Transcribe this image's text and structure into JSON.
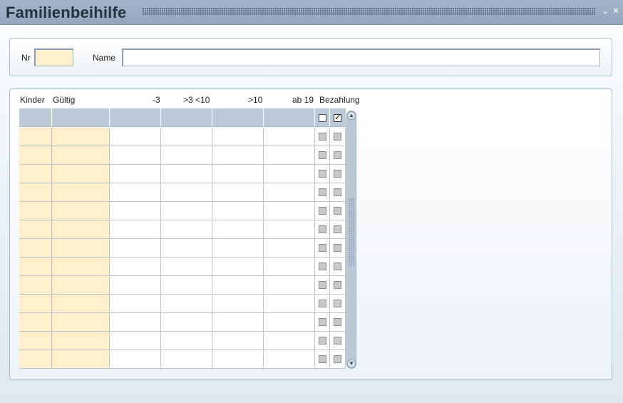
{
  "window": {
    "title": "Familienbeihilfe",
    "buttons": {
      "minimize_glyph": "⌄",
      "close_glyph": "✕"
    }
  },
  "header_form": {
    "nr_label": "Nr",
    "nr_value": "",
    "name_label": "Name",
    "name_value": ""
  },
  "table": {
    "columns": [
      "Kinder",
      "Gültig",
      "-3",
      ">3 <10",
      ">10",
      "ab 19",
      "Bezahlung"
    ],
    "header_row": {
      "checkbox_1_checked": false,
      "checkbox_2_checked": true
    },
    "row_count": 13,
    "rows": [
      {
        "kinder": "",
        "gueltig": "",
        "u3": "",
        "b3_10": "",
        "ue10": "",
        "ab19": "",
        "bez1": false,
        "bez2": false
      },
      {
        "kinder": "",
        "gueltig": "",
        "u3": "",
        "b3_10": "",
        "ue10": "",
        "ab19": "",
        "bez1": false,
        "bez2": false
      },
      {
        "kinder": "",
        "gueltig": "",
        "u3": "",
        "b3_10": "",
        "ue10": "",
        "ab19": "",
        "bez1": false,
        "bez2": false
      },
      {
        "kinder": "",
        "gueltig": "",
        "u3": "",
        "b3_10": "",
        "ue10": "",
        "ab19": "",
        "bez1": false,
        "bez2": false
      },
      {
        "kinder": "",
        "gueltig": "",
        "u3": "",
        "b3_10": "",
        "ue10": "",
        "ab19": "",
        "bez1": false,
        "bez2": false
      },
      {
        "kinder": "",
        "gueltig": "",
        "u3": "",
        "b3_10": "",
        "ue10": "",
        "ab19": "",
        "bez1": false,
        "bez2": false
      },
      {
        "kinder": "",
        "gueltig": "",
        "u3": "",
        "b3_10": "",
        "ue10": "",
        "ab19": "",
        "bez1": false,
        "bez2": false
      },
      {
        "kinder": "",
        "gueltig": "",
        "u3": "",
        "b3_10": "",
        "ue10": "",
        "ab19": "",
        "bez1": false,
        "bez2": false
      },
      {
        "kinder": "",
        "gueltig": "",
        "u3": "",
        "b3_10": "",
        "ue10": "",
        "ab19": "",
        "bez1": false,
        "bez2": false
      },
      {
        "kinder": "",
        "gueltig": "",
        "u3": "",
        "b3_10": "",
        "ue10": "",
        "ab19": "",
        "bez1": false,
        "bez2": false
      },
      {
        "kinder": "",
        "gueltig": "",
        "u3": "",
        "b3_10": "",
        "ue10": "",
        "ab19": "",
        "bez1": false,
        "bez2": false
      },
      {
        "kinder": "",
        "gueltig": "",
        "u3": "",
        "b3_10": "",
        "ue10": "",
        "ab19": "",
        "bez1": false,
        "bez2": false
      },
      {
        "kinder": "",
        "gueltig": "",
        "u3": "",
        "b3_10": "",
        "ue10": "",
        "ab19": "",
        "bez1": false,
        "bez2": false
      }
    ]
  },
  "colors": {
    "titlebar": "#9aadc3",
    "required_field": "#ffefcc",
    "grid_header": "#bccad9",
    "panel_border": "#9fc1cc"
  }
}
